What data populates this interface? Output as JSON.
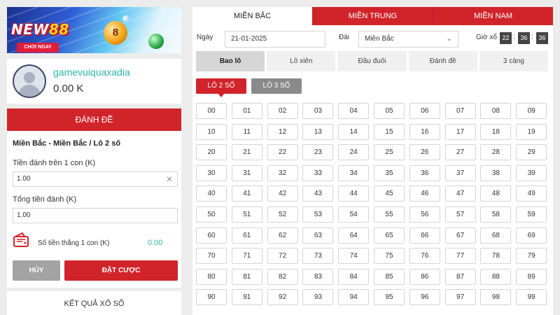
{
  "banner": {
    "logo_text": "NEW88",
    "cta_label": "CHƠI NGAY",
    "ball_number": "8"
  },
  "profile": {
    "username": "gamevuiquaxadia",
    "balance": "0.00 K"
  },
  "bet_panel": {
    "header": "ĐÁNH ĐỀ",
    "path": "Miền Bắc - Miền Bắc / Lô 2 số",
    "stake_label": "Tiền đánh trên 1 con (K)",
    "stake_value": "1.00",
    "total_label": "Tổng tiền đánh (K)",
    "total_value": "1.00",
    "win_label": "Số tiền thắng 1 con (K)",
    "win_value": "0.00",
    "cancel_label": "HỦY",
    "place_label": "ĐẶT CƯỢC"
  },
  "results": {
    "title": "KẾT QUẢ XỔ SỐ"
  },
  "region_tabs": [
    {
      "label": "MIỀN BẮC",
      "active": true
    },
    {
      "label": "MIỀN TRUNG",
      "active": false
    },
    {
      "label": "MIỀN NAM",
      "active": false
    }
  ],
  "filters": {
    "date_label": "Ngày",
    "date_value": "21-01-2025",
    "station_label": "Đài",
    "station_value": "Miền Bắc",
    "time_label": "Giờ xổ",
    "time": {
      "h": "22",
      "m": "36",
      "s": "36"
    }
  },
  "bet_types": [
    {
      "label": "Bao lô",
      "active": true
    },
    {
      "label": "Lô xiên",
      "active": false
    },
    {
      "label": "Đầu đuôi",
      "active": false
    },
    {
      "label": "Đánh đề",
      "active": false
    },
    {
      "label": "3 càng",
      "active": false
    }
  ],
  "sub_types": [
    {
      "label": "LÔ 2 SỐ",
      "active": true
    },
    {
      "label": "LÔ 3 SỐ",
      "active": false
    }
  ],
  "numbers": [
    "00",
    "01",
    "02",
    "03",
    "04",
    "05",
    "06",
    "07",
    "08",
    "09",
    "10",
    "11",
    "12",
    "13",
    "14",
    "15",
    "16",
    "17",
    "18",
    "19",
    "20",
    "21",
    "22",
    "23",
    "24",
    "25",
    "26",
    "27",
    "28",
    "29",
    "30",
    "31",
    "32",
    "33",
    "34",
    "35",
    "36",
    "37",
    "38",
    "39",
    "40",
    "41",
    "42",
    "43",
    "44",
    "45",
    "46",
    "47",
    "48",
    "49",
    "50",
    "51",
    "52",
    "53",
    "54",
    "55",
    "56",
    "57",
    "58",
    "59",
    "60",
    "61",
    "62",
    "63",
    "64",
    "65",
    "66",
    "67",
    "68",
    "69",
    "70",
    "71",
    "72",
    "73",
    "74",
    "75",
    "76",
    "77",
    "78",
    "79",
    "80",
    "81",
    "82",
    "83",
    "84",
    "85",
    "86",
    "87",
    "88",
    "89",
    "90",
    "91",
    "92",
    "93",
    "94",
    "95",
    "96",
    "97",
    "98",
    "99"
  ],
  "colors": {
    "brand_red": "#d0242a",
    "teal": "#2db4a8",
    "gray_button": "#a3a3a3"
  }
}
